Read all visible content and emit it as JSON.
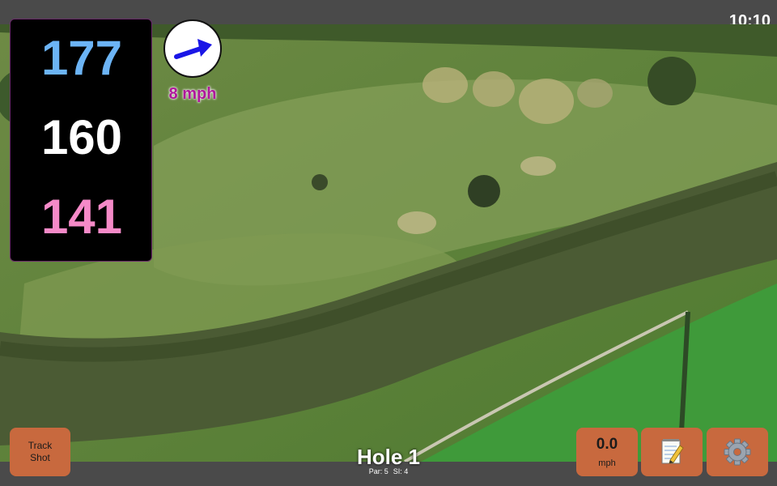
{
  "status_bar": {
    "time": "10:10"
  },
  "distances": {
    "back": {
      "value": "177",
      "color": "#6cb4f5"
    },
    "middle": {
      "value": "160",
      "color": "#ffffff"
    },
    "front": {
      "value": "141",
      "color": "#f58ac8"
    }
  },
  "wind": {
    "speed_label": "8 mph",
    "speed_color": "#b0169c",
    "arrow_icon": "wind-direction-arrow-icon",
    "arrow_color": "#1a16e6"
  },
  "buttons": {
    "track_shot": {
      "line1": "Track",
      "line2": "Shot"
    },
    "wind_readout": {
      "value": "0.0",
      "unit": "mph"
    },
    "notes_icon": "notepad-pencil-icon",
    "settings_icon": "gear-icon",
    "color": "#c8693e"
  },
  "hole": {
    "title": "Hole 1",
    "par": "Par: 5",
    "stroke_index": "SI: 4"
  }
}
